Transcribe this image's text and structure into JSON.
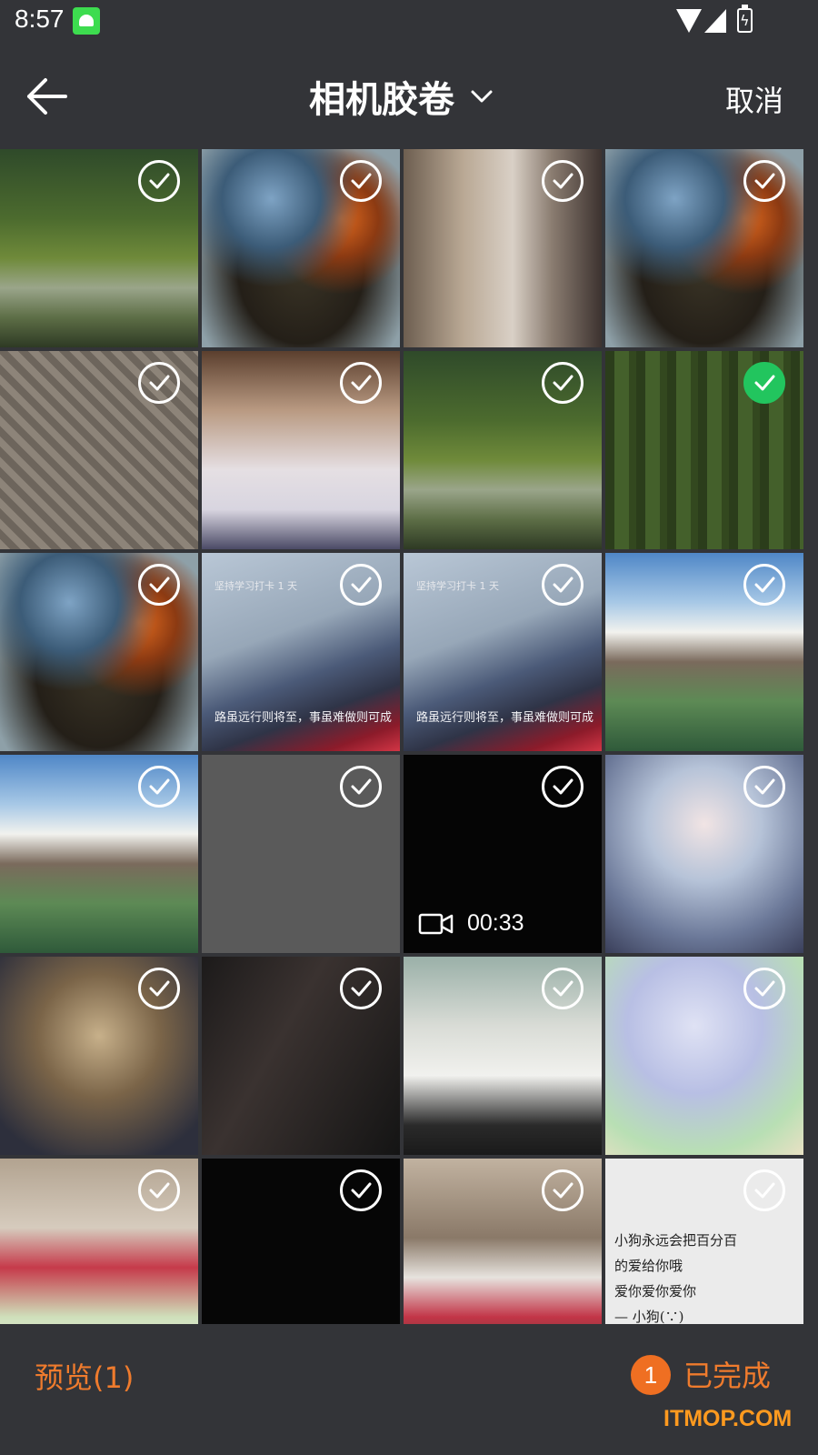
{
  "status_bar": {
    "time": "8:57"
  },
  "header": {
    "title": "相机胶卷",
    "cancel_label": "取消"
  },
  "grid": {
    "items": [
      {
        "kind": "river",
        "selected": false
      },
      {
        "kind": "planet",
        "selected": false
      },
      {
        "kind": "girls-collage",
        "selected": false
      },
      {
        "kind": "planet",
        "selected": false
      },
      {
        "kind": "newspaper-girl",
        "selected": false
      },
      {
        "kind": "reading-girl",
        "selected": false
      },
      {
        "kind": "river",
        "selected": false
      },
      {
        "kind": "forest",
        "selected": true
      },
      {
        "kind": "planet",
        "selected": false
      },
      {
        "kind": "study-card",
        "selected": false,
        "card_top": "坚持学习打卡 1 天",
        "card_bottom": "路虽远行则将至，事虽难做则可成"
      },
      {
        "kind": "study-card",
        "selected": false,
        "card_top": "坚持学习打卡 1 天",
        "card_bottom": "路虽远行则将至，事虽难做则可成"
      },
      {
        "kind": "mountain",
        "selected": false
      },
      {
        "kind": "mountain",
        "selected": false
      },
      {
        "kind": "gray",
        "selected": false
      },
      {
        "kind": "video",
        "selected": false,
        "duration": "00:33"
      },
      {
        "kind": "fantasy-girl",
        "selected": false
      },
      {
        "kind": "blonde-girl",
        "selected": false
      },
      {
        "kind": "dark-portrait",
        "selected": false
      },
      {
        "kind": "school-girl",
        "selected": false
      },
      {
        "kind": "anime-tea",
        "selected": false
      },
      {
        "kind": "photo-collage",
        "selected": false
      },
      {
        "kind": "black",
        "selected": false
      },
      {
        "kind": "couple-collage",
        "selected": false
      },
      {
        "kind": "note",
        "selected": false,
        "note_lines": [
          "小狗永远会把百分百",
          "的爱给你哦",
          "爱你爱你爱你",
          "— 小狗(∵)"
        ]
      }
    ]
  },
  "bottom_bar": {
    "preview_label": "预览(1)",
    "count_badge": "1",
    "done_label": "已完成"
  },
  "watermark": "ITMOP.COM",
  "colors": {
    "accent": "#ef7b2d",
    "selected": "#22c55e",
    "background": "#333438"
  }
}
